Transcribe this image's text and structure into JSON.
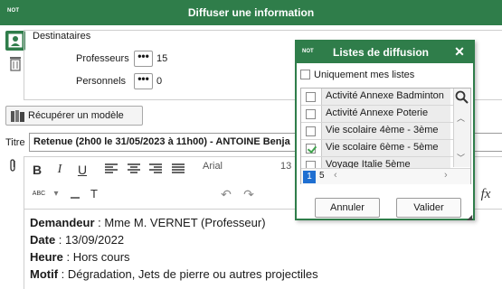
{
  "window": {
    "tag": "NOT",
    "title": "Diffuser une information"
  },
  "recipients": {
    "title": "Destinataires",
    "professeurs_label": "Professeurs",
    "professeurs_count": "15",
    "personnels_label": "Personnels",
    "personnels_count": "0",
    "dots": "•••"
  },
  "model_button": {
    "label": "Récupérer un modèle"
  },
  "titre": {
    "label": "Titre",
    "value": "Retenue  (2h00 le 31/05/2023 à 11h00) - ANTOINE Benja"
  },
  "toolbar": {
    "bold": "B",
    "italic": "I",
    "underline": "U",
    "font": "Arial",
    "size": "13",
    "spell": "ABC",
    "clear_format": "T",
    "fx": "fx"
  },
  "editor": {
    "lines": [
      {
        "label": "Demandeur",
        "value": " : Mme M. VERNET (Professeur)"
      },
      {
        "label": "Date",
        "value": " : 13/09/2022"
      },
      {
        "label": "Heure",
        "value": " : Hors cours"
      },
      {
        "label": "Motif",
        "value": " : Dégradation, Jets de pierre ou autres projectiles"
      }
    ]
  },
  "popup": {
    "tag": "NOT",
    "title": "Listes de diffusion",
    "close": "✕",
    "only_mine_label": "Uniquement mes listes",
    "lists": [
      {
        "name": "Activité Annexe Badminton",
        "checked": false
      },
      {
        "name": "Activité Annexe Poterie",
        "checked": false
      },
      {
        "name": "Vie scolaire 4ème - 3ème",
        "checked": false
      },
      {
        "name": "Vie scolaire 6ème - 5ème",
        "checked": true
      },
      {
        "name": "Voyage Italie 5ème",
        "checked": false
      }
    ],
    "pages": [
      "1",
      "5"
    ],
    "cancel_label": "Annuler",
    "ok_label": "Valider"
  },
  "colors": {
    "accent": "#2f7d4a",
    "page_active": "#1f6fd1",
    "check": "#3fa34d"
  }
}
